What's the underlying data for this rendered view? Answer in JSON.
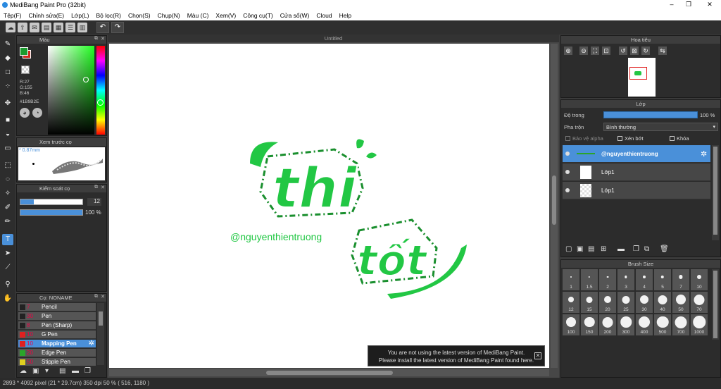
{
  "title": "MediBang Paint Pro (32bit)",
  "menu": [
    "Tệp(F)",
    "Chỉnh sửa(E)",
    "Lớp(L)",
    "Bộ lọc(R)",
    "Chọn(S)",
    "Chụp(N)",
    "Màu (C)",
    "Xem(V)",
    "Công cụ(T)",
    "Cửa sổ(W)",
    "Cloud",
    "Help"
  ],
  "color_panel": {
    "title": "Màu",
    "r": "R:27",
    "g": "G:155",
    "b": "B:46",
    "hex": "#1B9B2E",
    "fg": "#1b9b2e",
    "bg": "#cc2a1e"
  },
  "brush_preview": {
    "title": "Xem trước cọ",
    "size": "* 0.87mm"
  },
  "brush_control": {
    "title": "Kiểm soát cọ",
    "size": "12",
    "opacity": "100 %"
  },
  "brush_list": {
    "title": "Cọ: NONAME",
    "items": [
      {
        "size": "7",
        "name": "Pencil",
        "color": "#222"
      },
      {
        "size": "30",
        "name": "Pen",
        "color": "#222"
      },
      {
        "size": "8",
        "name": "Pen (Sharp)",
        "color": "#222"
      },
      {
        "size": "10",
        "name": "G Pen",
        "color": "#e02020"
      },
      {
        "size": "10",
        "name": "Mapping Pen",
        "color": "#e02020"
      },
      {
        "size": "20",
        "name": "Edge Pen",
        "color": "#2aa52a"
      },
      {
        "size": "50",
        "name": "Stipple Pen",
        "color": "#e0d020"
      }
    ]
  },
  "canvas": {
    "tab": "Untitled",
    "text_a": "thi",
    "text_b": "tốt",
    "handle": "@nguyenthientruong",
    "green": "#22c744"
  },
  "notification": {
    "line1": "You are not using the latest version of MediBang Paint.",
    "line2": "Please install the latest version of MediBang Paint found here."
  },
  "status": "2893 * 4092 pixel   (21 * 29.7cm)  350 dpi  50 %  ( 516, 1180 )",
  "navigator": {
    "title": "Hoa tiêu"
  },
  "layer_panel": {
    "title": "Lớp",
    "opacity_label": "Độ trong",
    "opacity_value": "100 %",
    "blend_label": "Pha trộn",
    "blend_value": "Bình thường",
    "protect_alpha": "Bảo vệ alpha",
    "clipping": "Xén bớt",
    "lock": "Khóa",
    "layers": [
      {
        "name": "@nguyenthientruong"
      },
      {
        "name": "Lớp1"
      },
      {
        "name": "Lớp1"
      }
    ]
  },
  "brush_size": {
    "title": "Brush Size",
    "sizes": [
      "1",
      "1.5",
      "2",
      "3",
      "4",
      "5",
      "7",
      "10",
      "12",
      "15",
      "20",
      "25",
      "30",
      "40",
      "50",
      "70",
      "100",
      "150",
      "200",
      "300",
      "400",
      "500",
      "700",
      "1000"
    ]
  }
}
